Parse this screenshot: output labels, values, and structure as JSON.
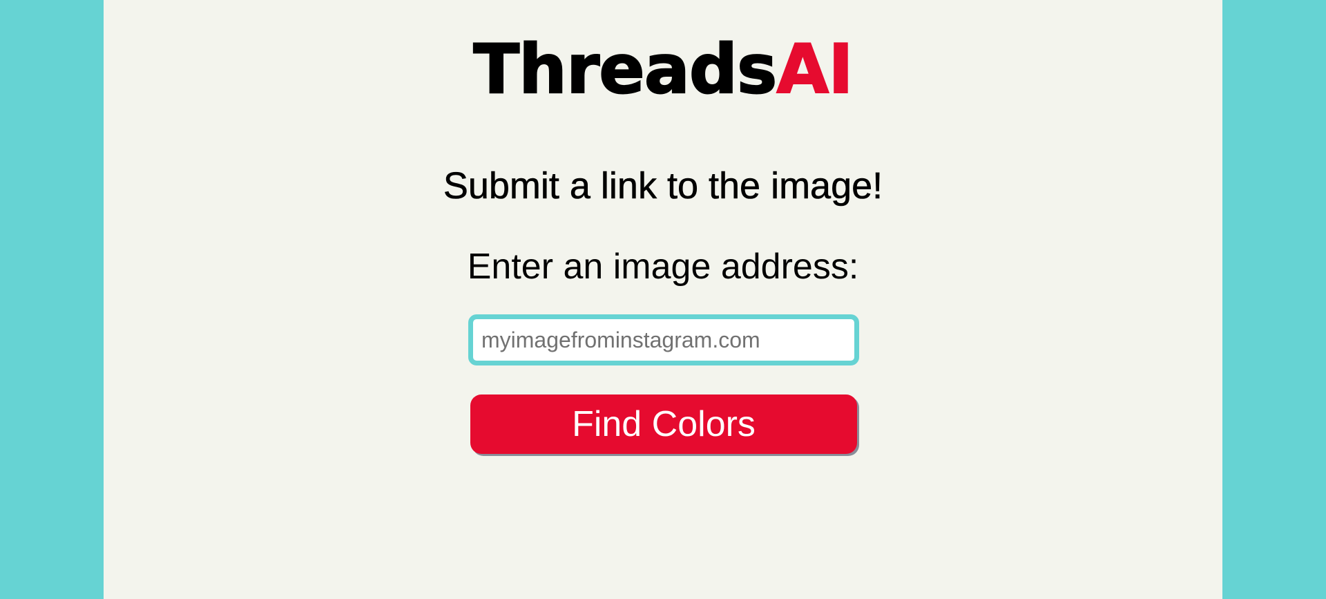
{
  "brand": {
    "name_part": "Threads",
    "accent_part": "AI",
    "accent_color": "#e60b2f"
  },
  "form": {
    "heading": "Submit a link to the image!",
    "label": "Enter an image address:",
    "input_value": "",
    "input_placeholder": "myimagefrominstagram.com",
    "submit_label": "Find Colors"
  },
  "colors": {
    "background": "#66d3d3",
    "panel": "#f3f4ed",
    "button": "#e60b2f",
    "input_border": "#66d3d3"
  }
}
